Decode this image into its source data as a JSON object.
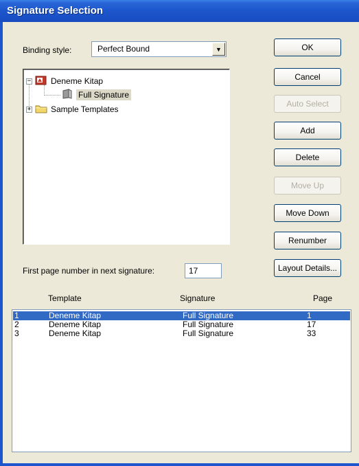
{
  "window": {
    "title": "Signature Selection"
  },
  "binding": {
    "label": "Binding style:",
    "value": "Perfect Bound"
  },
  "tree": {
    "items": [
      {
        "label": "Deneme Kitap",
        "expander": "−"
      },
      {
        "label": "Full Signature"
      },
      {
        "label": "Sample Templates",
        "expander": "+"
      }
    ]
  },
  "buttons": {
    "ok": "OK",
    "cancel": "Cancel",
    "auto_select": "Auto Select",
    "add": "Add",
    "delete": "Delete",
    "move_up": "Move Up",
    "move_down": "Move Down",
    "renumber": "Renumber",
    "layout_details": "Layout Details..."
  },
  "first_page": {
    "label": "First page number in next signature:",
    "value": "17"
  },
  "table": {
    "headers": {
      "template": "Template",
      "signature": "Signature",
      "page": "Page"
    },
    "rows": [
      {
        "num": "1",
        "template": "Deneme Kitap",
        "signature": "Full Signature",
        "page": "1"
      },
      {
        "num": "2",
        "template": "Deneme Kitap",
        "signature": "Full Signature",
        "page": "17"
      },
      {
        "num": "3",
        "template": "Deneme Kitap",
        "signature": "Full Signature",
        "page": "33"
      }
    ]
  },
  "colors": {
    "titlebar": "#1c55cc",
    "selection": "#316ac5",
    "dialog": "#ece9d8"
  }
}
